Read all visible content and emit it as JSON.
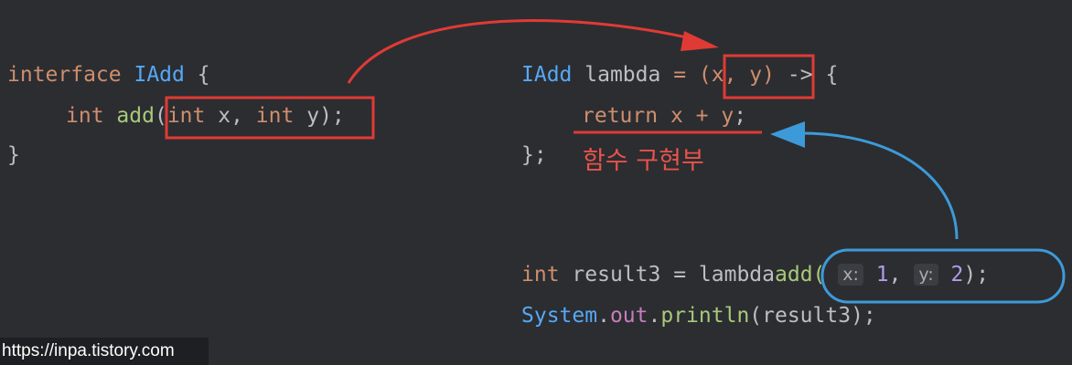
{
  "code_left": {
    "line1": {
      "kw": "interface",
      "type": "IAdd",
      "brace": "{"
    },
    "line2": {
      "kw1": "int",
      "fn": "add",
      "open": "(",
      "kw2": "int",
      "p1": "x",
      "comma": ",",
      "kw3": "int",
      "p2": "y",
      "close": ")",
      "semi": ";"
    },
    "line3": {
      "brace": "}"
    }
  },
  "code_right": {
    "line1": {
      "type": "IAdd",
      "var": "lambda",
      "eq": "=",
      "params": "(x, y)",
      "arrow": "->",
      "brace": "{"
    },
    "line2": {
      "kw": "return",
      "expr": "x + y",
      "semi": ";"
    },
    "line3": {
      "close": "};"
    },
    "label": "함수 구현부",
    "line4": {
      "kw": "int",
      "var": "result3",
      "eq": "=",
      "obj": "lambda",
      "fn": "add(",
      "hint_x": "x:",
      "arg1": "1",
      "comma": ",",
      "hint_y": "y:",
      "arg2": "2",
      "close": ");"
    },
    "line5": {
      "cls": "System",
      "dot1": ".",
      "fld": "out",
      "dot2": ".",
      "fn": "println",
      "args": "(result3);"
    }
  },
  "annotation_colors": {
    "red": "#e03a35",
    "blue": "#3d9ad8"
  },
  "watermark": "https://inpa.tistory.com"
}
